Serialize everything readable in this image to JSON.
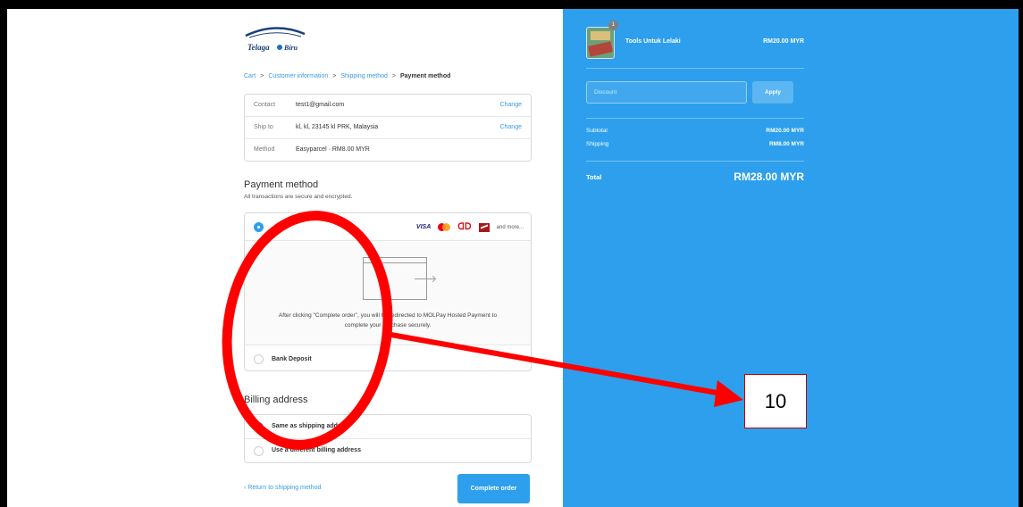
{
  "logo": {
    "text": "Telaga",
    "text2": "Biru",
    "alt": "Telaga Biru logo"
  },
  "breadcrumb": [
    "Cart",
    "Customer information",
    "Shipping method",
    "Payment method"
  ],
  "review": {
    "contact": {
      "label": "Contact",
      "value": "test1@gmail.com",
      "change": "Change"
    },
    "ship_to": {
      "label": "Ship to",
      "value": "kl, kl, 23145 kl PRK, Malaysia",
      "change": "Change"
    },
    "method": {
      "label": "Method",
      "value": "Easyparcel · RM8.00 MYR"
    }
  },
  "payment": {
    "title": "Payment method",
    "subtitle": "All transactions are secure and encrypted.",
    "cards": [
      "VISA",
      "mastercard-icon",
      "molpay-icon",
      "maybank-icon"
    ],
    "visa_label": "VISA",
    "and_more": "and more...",
    "redirect_text": "After clicking \"Complete order\", you will be redirected to MOLPay Hosted Payment to complete your purchase securely.",
    "bank_deposit": "Bank Deposit",
    "selected": "molpay"
  },
  "billing": {
    "title": "Billing address",
    "options": [
      "Same as shipping address",
      "Use a different billing address"
    ],
    "selected": 0
  },
  "footer": {
    "return_link": "‹ Return to shipping method",
    "complete_button": "Complete order"
  },
  "summary": {
    "quantity": "1",
    "product_name": "Tools Untuk Lelaki",
    "product_price": "RM20.00 MYR",
    "discount_placeholder": "Discount",
    "apply_button": "Apply",
    "subtotal_label": "Subtotal",
    "subtotal_value": "RM20.00 MYR",
    "shipping_label": "Shipping",
    "shipping_value": "RM8.00 MYR",
    "total_label": "Total",
    "total_value": "RM28.00 MYR"
  },
  "annotation": {
    "label": "10"
  },
  "colors": {
    "accent": "#2d9fec",
    "annotation": "#ff0000",
    "link": "#3b9ae1"
  }
}
